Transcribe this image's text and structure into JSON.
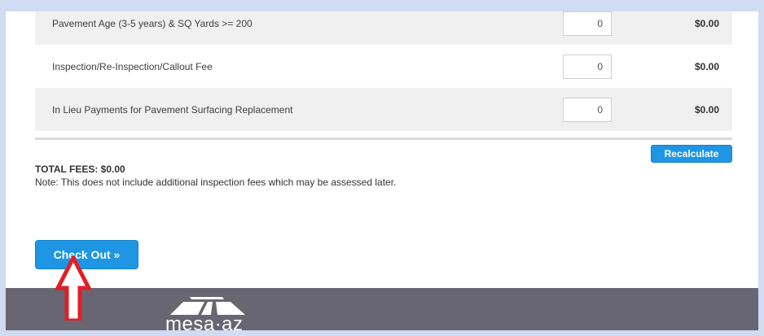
{
  "fees": [
    {
      "label": "Pavement Age (3-5 years) & SQ Yards >= 200",
      "quantity": "0",
      "amount": "$0.00"
    },
    {
      "label": "Inspection/Re-Inspection/Callout Fee",
      "quantity": "0",
      "amount": "$0.00"
    },
    {
      "label": "In Lieu Payments for Pavement Surfacing Replacement",
      "quantity": "0",
      "amount": "$0.00"
    }
  ],
  "recalculate_label": "Recalculate",
  "total_fees": "TOTAL FEES: $0.00",
  "note": "Note: This does not include additional inspection fees which may be assessed later.",
  "checkout_label": "Check Out »",
  "footer": {
    "logo_text": "mesa·az",
    "logo_icon": "mesa-az-logo-icon",
    "background": "#686672"
  },
  "annotation": {
    "icon": "red-arrow-up-icon",
    "color": "#e01f26"
  },
  "accent_color": "#1e96e4"
}
